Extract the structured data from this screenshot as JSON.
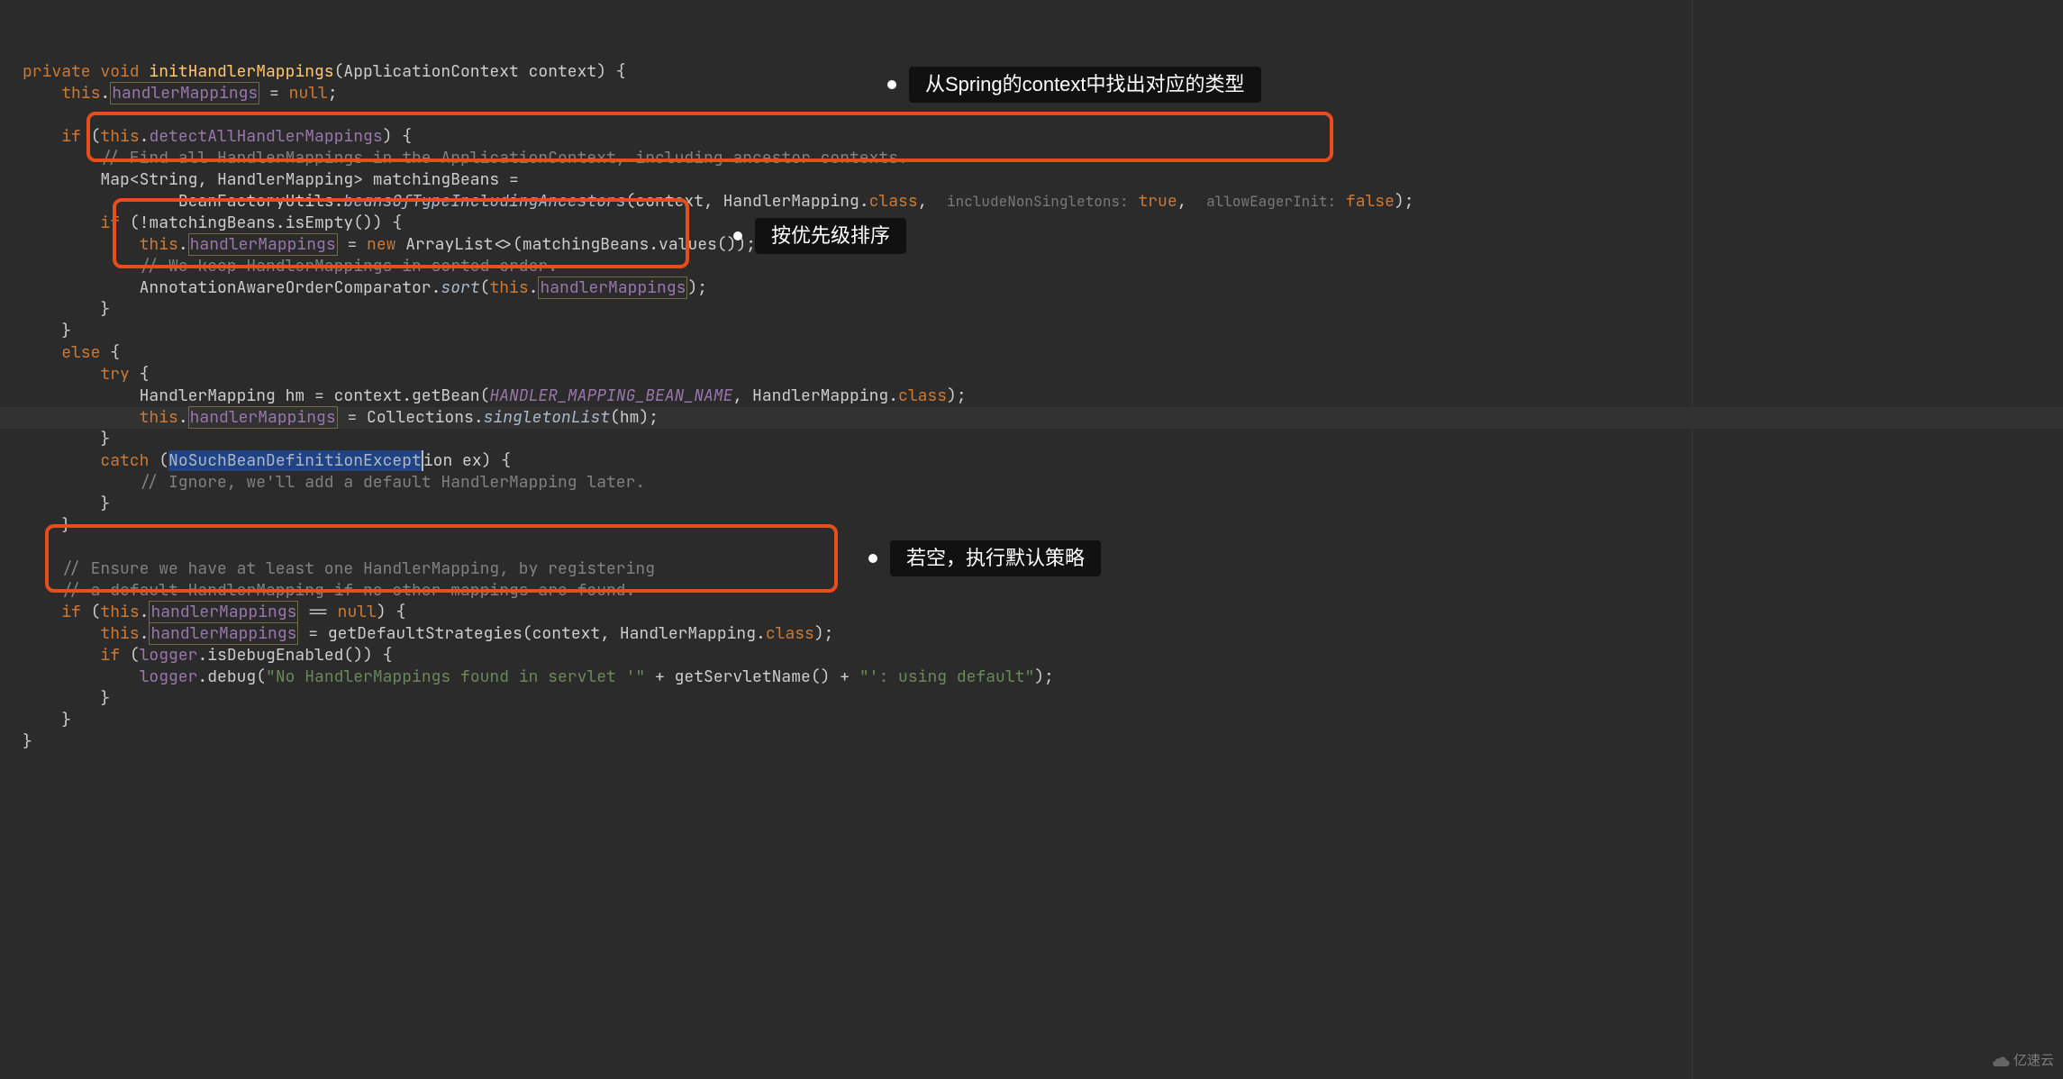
{
  "code": {
    "l1": "private void initHandlerMappings(ApplicationContext context) {",
    "l2": "    this.handlerMappings = null;",
    "l3": "",
    "l4": "    if (this.detectAllHandlerMappings) {",
    "l5": "        // Find all HandlerMappings in the ApplicationContext, including ancestor contexts.",
    "l6": "        Map<String, HandlerMapping> matchingBeans =",
    "l7": "                BeanFactoryUtils.beansOfTypeIncludingAncestors(context, HandlerMapping.class,  includeNonSingletons: true,  allowEagerInit: false);",
    "l8": "        if (!matchingBeans.isEmpty()) {",
    "l9": "            this.handlerMappings = new ArrayList<>(matchingBeans.values());",
    "l10": "            // We keep HandlerMappings in sorted order.",
    "l11": "            AnnotationAwareOrderComparator.sort(this.handlerMappings);",
    "l12": "        }",
    "l13": "    }",
    "l14": "    else {",
    "l15": "        try {",
    "l16": "            HandlerMapping hm = context.getBean(HANDLER_MAPPING_BEAN_NAME, HandlerMapping.class);",
    "l17": "            this.handlerMappings = Collections.singletonList(hm);",
    "l18": "        }",
    "l19": "        catch (NoSuchBeanDefinitionException ex) {",
    "l20": "            // Ignore, we'll add a default HandlerMapping later.",
    "l21": "        }",
    "l22": "    }",
    "l23": "",
    "l24": "    // Ensure we have at least one HandlerMapping, by registering",
    "l25": "    // a default HandlerMapping if no other mappings are found.",
    "l26": "    if (this.handlerMappings == null) {",
    "l27": "        this.handlerMappings = getDefaultStrategies(context, HandlerMapping.class);",
    "l28": "        if (logger.isDebugEnabled()) {",
    "l29": "            logger.debug(\"No HandlerMappings found in servlet '\" + getServletName() + \"': using default\");",
    "l30": "        }",
    "l31": "    }",
    "l32": "}"
  },
  "annotations": {
    "a1": "从Spring的context中找出对应的类型",
    "a2": "按优先级排序",
    "a3": "若空，执行默认策略"
  },
  "hints": {
    "includeNonSingletons": "includeNonSingletons:",
    "allowEagerInit": "allowEagerInit:"
  },
  "watermark": "亿速云"
}
